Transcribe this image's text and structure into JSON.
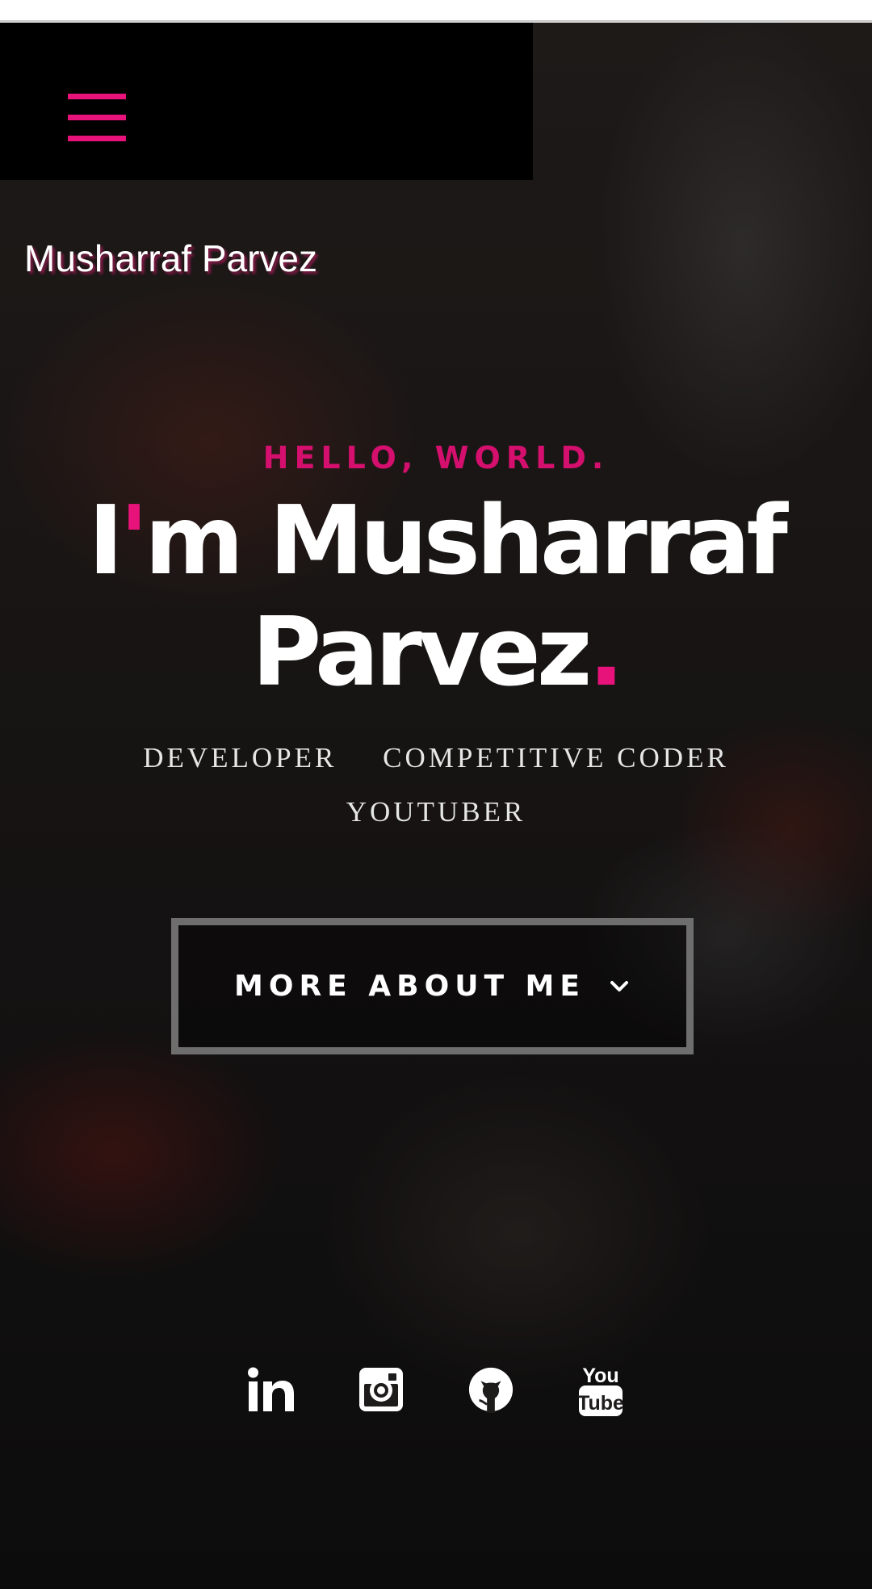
{
  "header": {
    "menu_icon": "hamburger-menu-icon",
    "site_name": "Musharraf Parvez"
  },
  "hero": {
    "greeting": "HELLO, WORLD.",
    "headline": {
      "prefix_1": "I",
      "apostrophe": "'",
      "prefix_2": "m Musharraf",
      "name_line2": "Parvez",
      "period": "."
    },
    "roles": [
      "DEVELOPER",
      "COMPETITIVE CODER",
      "YOUTUBER"
    ],
    "cta": {
      "label": "MORE ABOUT ME",
      "icon": "chevron-down-icon"
    }
  },
  "social_links": [
    {
      "name": "LinkedIn",
      "icon": "linkedin-icon"
    },
    {
      "name": "Instagram",
      "icon": "instagram-icon"
    },
    {
      "name": "GitHub",
      "icon": "github-icon"
    },
    {
      "name": "YouTube",
      "icon": "youtube-icon"
    }
  ],
  "colors": {
    "accent": "#e8137a",
    "greeting": "#d40f6d",
    "menu_bar": "#000000",
    "button_border": "#6e6e6e",
    "text": "#ffffff"
  }
}
